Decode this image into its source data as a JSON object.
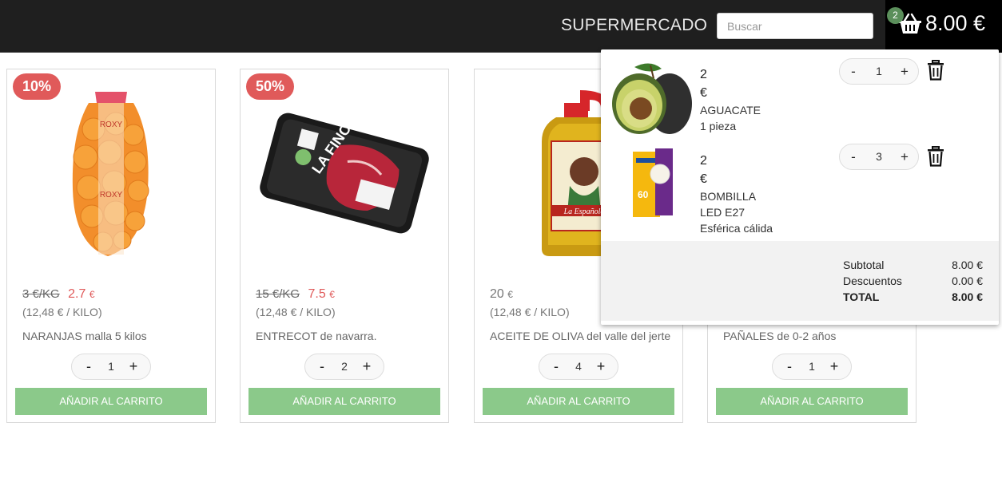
{
  "header": {
    "brand": "SUPERMERCADO",
    "search_placeholder": "Buscar",
    "cart_count": "2",
    "cart_total": "8.00 €"
  },
  "products": [
    {
      "badge": "10%",
      "old_price": "3 €/KG",
      "price": "2.7",
      "currency": "€",
      "unit": "(12,48 € / KILO)",
      "name": "NARANJAS malla 5 kilos",
      "qty": "1",
      "add_label": "AÑADIR AL CARRITO",
      "minus": "-",
      "plus": "+"
    },
    {
      "badge": "50%",
      "old_price": "15 €/KG",
      "price": "7.5",
      "currency": "€",
      "unit": "(12,48 € / KILO)",
      "name": "ENTRECOT de navarra.",
      "qty": "2",
      "add_label": "AÑADIR AL CARRITO",
      "minus": "-",
      "plus": "+"
    },
    {
      "price": "20",
      "currency": "€",
      "unit": "(12,48 € / KILO)",
      "name": "ACEITE DE OLIVA del valle del jerte",
      "qty": "4",
      "add_label": "AÑADIR AL CARRITO",
      "minus": "-",
      "plus": "+"
    },
    {
      "name": "PAÑALES de 0-2 años",
      "qty": "1",
      "add_label": "AÑADIR AL CARRITO",
      "minus": "-",
      "plus": "+"
    }
  ],
  "cart": {
    "items": [
      {
        "price": "2",
        "currency": "€",
        "name_lines": [
          "AGUACATE",
          "1 pieza"
        ],
        "qty": "1",
        "minus": "-",
        "plus": "+"
      },
      {
        "price": "2",
        "currency": "€",
        "name_lines": [
          "BOMBILLA",
          "LED E27",
          "Esférica cálida"
        ],
        "qty": "3",
        "minus": "-",
        "plus": "+"
      }
    ],
    "summary": {
      "subtotal_label": "Subtotal",
      "subtotal": "8.00 €",
      "discount_label": "Descuentos",
      "discount": "0.00 €",
      "total_label": "TOTAL",
      "total": "8.00 €"
    }
  },
  "colors": {
    "header_bg": "#1f1f1f",
    "badge": "#e05a5a",
    "add_button": "#8bc98a",
    "cart_count_badge": "#5b8f5b"
  },
  "icons": [
    "basket-icon",
    "trash-icon"
  ]
}
